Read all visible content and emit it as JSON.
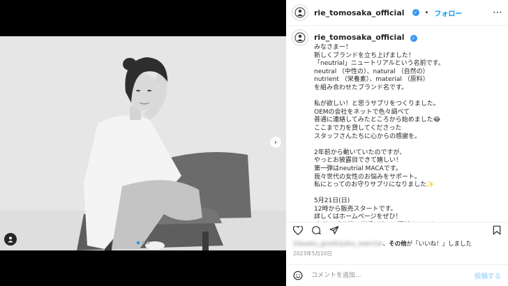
{
  "account": {
    "username": "rie_tomosaka_official",
    "follow_label": "フォロー"
  },
  "caption": {
    "username": "rie_tomosaka_official",
    "text": "みなさまー！\n新しくブランドを立ち上げました！\n「neutrial」ニュートリアルという名前です。\nneutral （中性の）、natural （自然の）\nnutrient （栄養素）、material （原料）\nを組み合わせたブランド名です。\n\n私が欲しい！と思うサプリをつくりました。\nOEMの会社をネットで色々調べて\n普通に連絡してみたところから始めました😂\nここまで力を貸してくださった\nスタッフさんたちに心からの感謝を。\n\n2年前から動いていたのですが、\nやっとお披露目できて嬉しい！\n第一弾はneutrial MACAです。\n我々世代の女性のお悩みをサポート。\n私にとってのお守りサプリになりました✨\n\n5月21日(日)\n12時から販売スタートです。\n詳しくはホームページをぜひ！\n(価格や成分等の詳細は追って更新されます)"
  },
  "likes": {
    "liker": "2daaatu_goodinjutsu_exercise",
    "others_label": "その他",
    "suffix": "が「いいね！」しました"
  },
  "date": "2023年5月10日",
  "comment": {
    "placeholder": "コメントを追加...",
    "post_label": "投稿する"
  },
  "carousel": {
    "slides": 3,
    "active": 0
  },
  "icons": [
    "more-icon",
    "verified-icon",
    "heart-icon",
    "comment-icon",
    "share-icon",
    "save-icon",
    "emoji-icon",
    "user-tag-icon",
    "next-arrow-icon"
  ],
  "colors": {
    "accent": "#0095f6",
    "verified": "#3797f0",
    "text": "#262626",
    "muted": "#8e8e8e"
  }
}
